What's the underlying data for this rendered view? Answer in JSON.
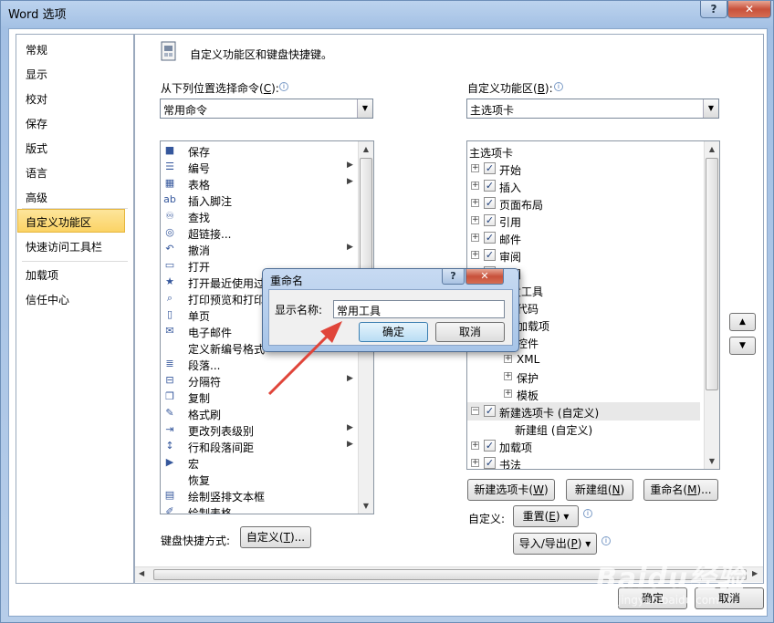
{
  "window": {
    "title": "Word 选项",
    "help": "?",
    "close": "✕"
  },
  "nav": {
    "items": [
      "常规",
      "显示",
      "校对",
      "保存",
      "版式",
      "语言",
      "高级",
      "自定义功能区",
      "快速访问工具栏",
      "加载项",
      "信任中心"
    ],
    "active_index": 7
  },
  "header": {
    "text": "自定义功能区和键盘快捷键。"
  },
  "left_panel": {
    "label": "从下列位置选择命令(",
    "label_key": "C",
    "label_tail": "):",
    "combo_value": "常用命令",
    "commands": [
      {
        "label": "保存",
        "icon": "floppy-icon",
        "glyph": "■",
        "submenu": false
      },
      {
        "label": "编号",
        "icon": "numbering-icon",
        "glyph": "☰",
        "submenu": true
      },
      {
        "label": "表格",
        "icon": "table-icon",
        "glyph": "▦",
        "submenu": true
      },
      {
        "label": "插入脚注",
        "icon": "footnote-icon",
        "glyph": "ab",
        "submenu": false
      },
      {
        "label": "查找",
        "icon": "binoculars-icon",
        "glyph": "♾",
        "submenu": false
      },
      {
        "label": "超链接...",
        "icon": "hyperlink-icon",
        "glyph": "◎",
        "submenu": false
      },
      {
        "label": "撤消",
        "icon": "undo-icon",
        "glyph": "↶",
        "submenu": true
      },
      {
        "label": "打开",
        "icon": "open-folder-icon",
        "glyph": "▭",
        "submenu": false
      },
      {
        "label": "打开最近使用过",
        "icon": "recent-file-icon",
        "glyph": "★",
        "submenu": false
      },
      {
        "label": "打印预览和打印",
        "icon": "print-preview-icon",
        "glyph": "⌕",
        "submenu": false
      },
      {
        "label": "单页",
        "icon": "single-page-icon",
        "glyph": "▯",
        "submenu": false
      },
      {
        "label": "电子邮件",
        "icon": "email-icon",
        "glyph": "✉",
        "submenu": false
      },
      {
        "label": "定义新编号格式",
        "icon": "blank-icon",
        "glyph": "",
        "submenu": false
      },
      {
        "label": "段落...",
        "icon": "paragraph-icon",
        "glyph": "≣",
        "submenu": false
      },
      {
        "label": "分隔符",
        "icon": "separator-icon",
        "glyph": "⊟",
        "submenu": true
      },
      {
        "label": "复制",
        "icon": "copy-icon",
        "glyph": "❐",
        "submenu": false
      },
      {
        "label": "格式刷",
        "icon": "format-painter-icon",
        "glyph": "✎",
        "submenu": false
      },
      {
        "label": "更改列表级别",
        "icon": "list-level-icon",
        "glyph": "⇥",
        "submenu": true
      },
      {
        "label": "行和段落间距",
        "icon": "line-spacing-icon",
        "glyph": "↕",
        "submenu": true
      },
      {
        "label": "宏",
        "icon": "macro-icon",
        "glyph": "▶",
        "submenu": false
      },
      {
        "label": "恢复",
        "icon": "blank-icon",
        "glyph": "",
        "submenu": false
      },
      {
        "label": "绘制竖排文本框",
        "icon": "textbox-icon",
        "glyph": "▤",
        "submenu": false
      },
      {
        "label": "绘制表格",
        "icon": "draw-table-icon",
        "glyph": "✐",
        "submenu": false
      }
    ],
    "keyboard_label": "键盘快捷方式:",
    "customize_button": "自定义(",
    "customize_key": "T",
    "customize_tail": ")..."
  },
  "right_panel": {
    "label": "自定义功能区(",
    "label_key": "B",
    "label_tail": "):",
    "combo_value": "主选项卡",
    "tree": [
      {
        "label": "主选项卡",
        "level": 0,
        "expander": "",
        "checkbox": false
      },
      {
        "label": "开始",
        "level": 1,
        "expander": "+",
        "checkbox": true
      },
      {
        "label": "插入",
        "level": 1,
        "expander": "+",
        "checkbox": true
      },
      {
        "label": "页面布局",
        "level": 1,
        "expander": "+",
        "checkbox": true
      },
      {
        "label": "引用",
        "level": 1,
        "expander": "+",
        "checkbox": true
      },
      {
        "label": "邮件",
        "level": 1,
        "expander": "+",
        "checkbox": true
      },
      {
        "label": "审阅",
        "level": 1,
        "expander": "+",
        "checkbox": true
      },
      {
        "label": "视图",
        "level": 1,
        "expander": "+",
        "checkbox": true
      },
      {
        "label": "开发工具",
        "level": 1,
        "expander": "-",
        "checkbox": true
      },
      {
        "label": "代码",
        "level": 2,
        "expander": "+",
        "checkbox": false
      },
      {
        "label": "加载项",
        "level": 2,
        "expander": "+",
        "checkbox": false
      },
      {
        "label": "控件",
        "level": 2,
        "expander": "+",
        "checkbox": false
      },
      {
        "label": "XML",
        "level": 2,
        "expander": "+",
        "checkbox": false
      },
      {
        "label": "保护",
        "level": 2,
        "expander": "+",
        "checkbox": false
      },
      {
        "label": "模板",
        "level": 2,
        "expander": "+",
        "checkbox": false
      },
      {
        "label": "新建选项卡 (自定义)",
        "level": 1,
        "expander": "-",
        "checkbox": true,
        "selected": true
      },
      {
        "label": "新建组 (自定义)",
        "level": 2,
        "expander": "",
        "checkbox": false
      },
      {
        "label": "加载项",
        "level": 1,
        "expander": "+",
        "checkbox": true
      },
      {
        "label": "书法",
        "level": 1,
        "expander": "+",
        "checkbox": true
      }
    ],
    "new_tab_button": "新建选项卡(",
    "new_tab_key": "W",
    "new_group_button": "新建组(",
    "new_group_key": "N",
    "rename_button": "重命名(",
    "rename_key": "M",
    "customize_label": "自定义:",
    "reset_button": "重置(",
    "reset_key": "E",
    "import_export_button": "导入/导出(",
    "import_export_key": "P",
    "move_up": "▲",
    "move_down": "▼"
  },
  "footer": {
    "ok": "确定",
    "cancel": "取消"
  },
  "rename_dialog": {
    "title": "重命名",
    "help": "?",
    "close": "✕",
    "field_label": "显示名称:",
    "field_value": "常用工具",
    "ok": "确定",
    "cancel": "取消"
  },
  "watermark": {
    "text": "Baidu经验",
    "sub": "jingyan.baidu.com"
  },
  "colors": {
    "nav_active": "#fbd365",
    "annotation_arrow": "#e0453a",
    "dialog_close": "#c8513b"
  }
}
